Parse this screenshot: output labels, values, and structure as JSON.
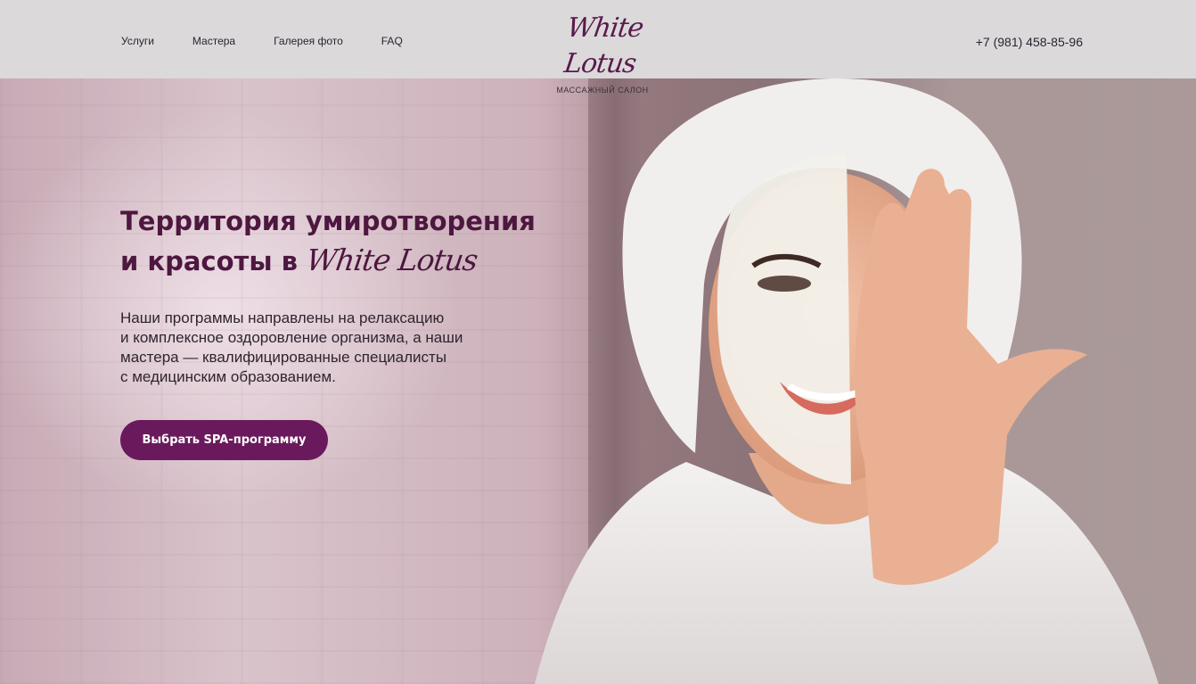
{
  "header": {
    "nav": [
      "Услуги",
      "Мастера",
      "Галерея фото",
      "FAQ"
    ],
    "logo_script": "White Lotus",
    "logo_sub": "МАССАЖНЫЙ САЛОН",
    "phone": "+7 (981) 458-85-96"
  },
  "hero": {
    "title_line1": "Территория умиротворения",
    "title_line2_prefix": "и красоты в",
    "title_script": "White Lotus",
    "description_lines": [
      "Наши программы направлены на релаксацию",
      "и комплексное оздоровление организма, а наши",
      "мастера — квалифицированные специалисты",
      "с медицинским образованием."
    ],
    "cta_label": "Выбрать SPA-программу"
  },
  "colors": {
    "brand": "#6a1a5c",
    "title": "#4d1740",
    "header_bg": "#dbd9da"
  }
}
